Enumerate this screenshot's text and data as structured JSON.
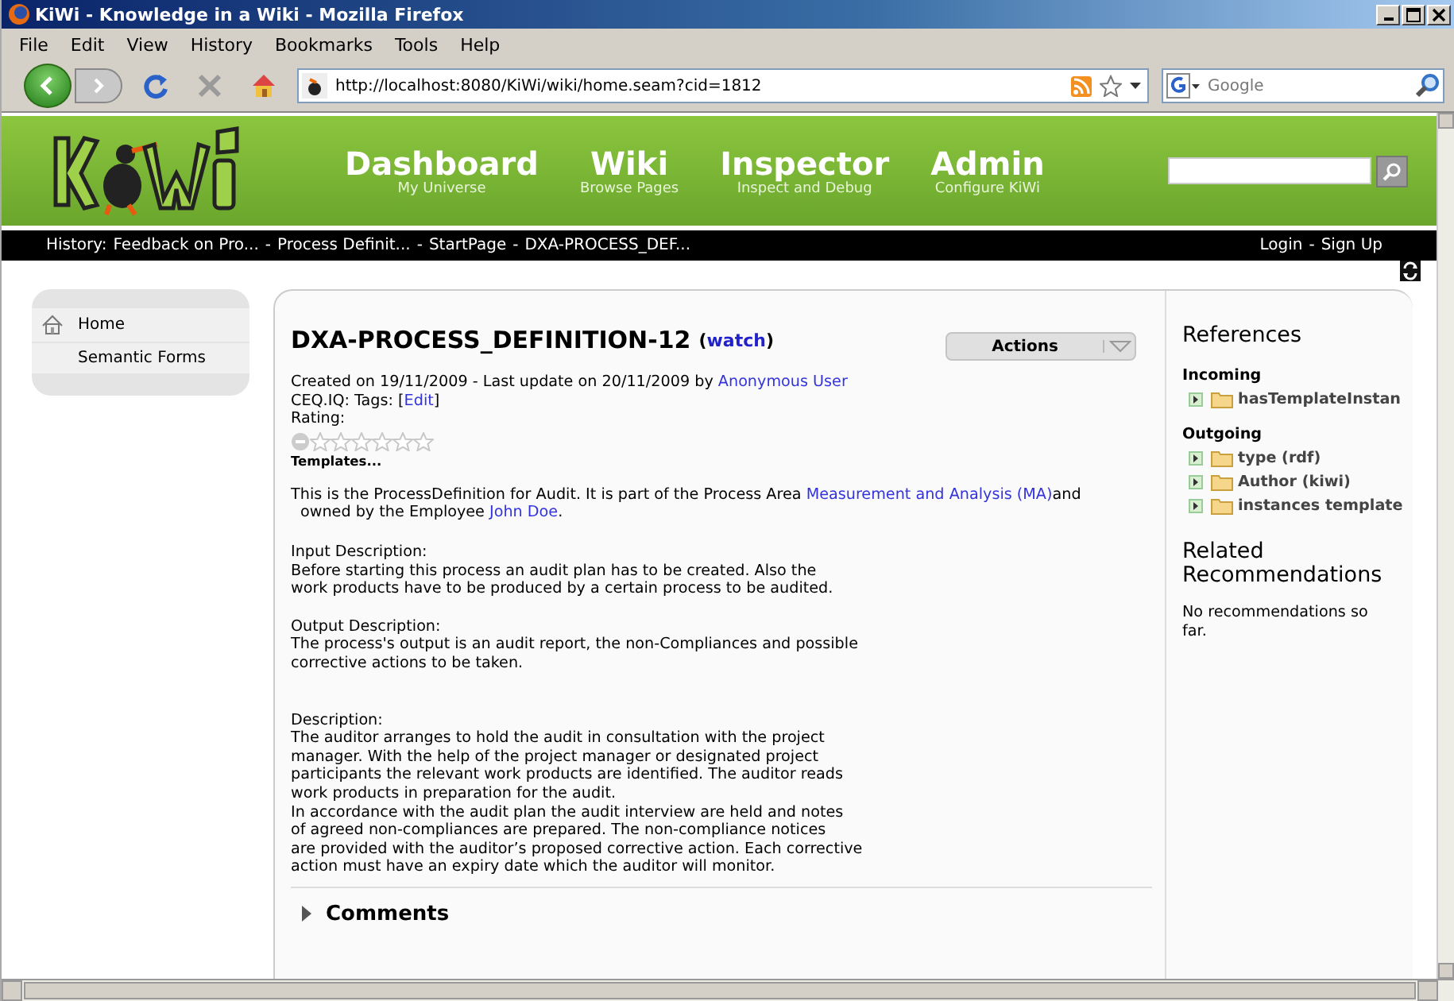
{
  "window": {
    "title": "KiWi - Knowledge in a Wiki - Mozilla Firefox"
  },
  "menu": [
    "File",
    "Edit",
    "View",
    "History",
    "Bookmarks",
    "Tools",
    "Help"
  ],
  "address_bar": {
    "url": "http://localhost:8080/KiWi/wiki/home.seam?cid=1812"
  },
  "search_bar": {
    "placeholder": "Google"
  },
  "site_nav": [
    {
      "title": "Dashboard",
      "subtitle": "My Universe"
    },
    {
      "title": "Wiki",
      "subtitle": "Browse Pages"
    },
    {
      "title": "Inspector",
      "subtitle": "Inspect and Debug"
    },
    {
      "title": "Admin",
      "subtitle": "Configure KiWi"
    }
  ],
  "history_bar": {
    "label": "History:",
    "separator": "-",
    "items": [
      "Feedback on Pro...",
      "Process Definit...",
      "StartPage",
      "DXA-PROCESS_DEF..."
    ],
    "login": "Login",
    "signup": "Sign Up"
  },
  "sidebar": {
    "items": [
      {
        "label": "Home",
        "icon": true
      },
      {
        "label": "Semantic Forms",
        "icon": false
      }
    ]
  },
  "article": {
    "title": "DXA-PROCESS_DEFINITION-12",
    "watch": "watch",
    "watch_open": "(",
    "watch_close": ")",
    "actions": "Actions",
    "meta": [
      {
        "kind": "text",
        "text": "Created on 19/11/2009 - Last update on 20/11/2009 by "
      },
      {
        "kind": "link",
        "text": "Anonymous User"
      }
    ],
    "tags": [
      {
        "kind": "text",
        "text": "CEQ.IQ: Tags: ["
      },
      {
        "kind": "link",
        "text": "Edit"
      },
      {
        "kind": "text",
        "text": "]"
      }
    ],
    "rating_label": "Rating:",
    "stars": 0,
    "templates": "Templates...",
    "intro": [
      {
        "kind": "text",
        "text": "This is the ProcessDefinition for Audit. It is part of the Process Area "
      },
      {
        "kind": "link",
        "text": "Measurement and Analysis (MA)"
      },
      {
        "kind": "text",
        "text": "and"
      },
      {
        "kind": "break"
      },
      {
        "kind": "text",
        "text": "owned by the Employee "
      },
      {
        "kind": "link",
        "text": "John Doe"
      },
      {
        "kind": "text",
        "text": "."
      }
    ],
    "sections": [
      {
        "heading": "Input Description:",
        "lines": [
          "Before starting this process an audit plan has to be created. Also the",
          "work products have to be produced by a certain process to be audited."
        ]
      },
      {
        "heading": "Output Description:",
        "lines": [
          "The process's output is an audit report, the non-Compliances and possible",
          "corrective actions to be taken."
        ]
      },
      {
        "heading": "Description:",
        "lines": [
          "The auditor arranges to hold the audit in consultation with the project",
          "manager. With the help of the project manager or designated project",
          "participants the relevant work products are identified. The auditor reads",
          "work products in preparation for the audit.",
          "In accordance with the audit plan the audit interview are held and notes",
          "of agreed non-compliances are prepared. The non-compliance notices",
          "are provided with the auditor’s proposed corrective action. Each corrective",
          "action must have an expiry date which the auditor will monitor."
        ]
      }
    ],
    "comments": {
      "label": "Comments",
      "expanded": false
    }
  },
  "references": {
    "title": "References",
    "groups": [
      {
        "label": "Incoming",
        "items": [
          "hasTemplateInstan"
        ]
      },
      {
        "label": "Outgoing",
        "items": [
          "type (rdf)",
          "Author (kiwi)",
          "instances template"
        ]
      }
    ],
    "related_title": "Related Recommendations",
    "related_text": "No recommendations so far."
  }
}
